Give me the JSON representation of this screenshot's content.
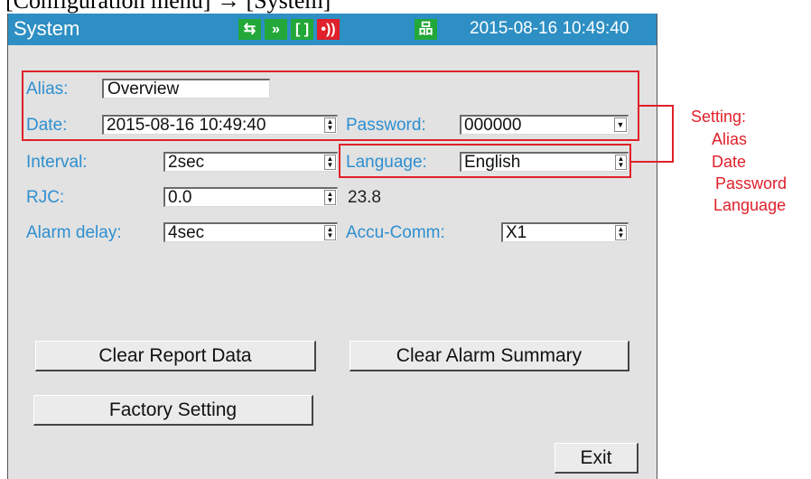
{
  "caption": "[Configuration menu] → [System]",
  "titlebar": {
    "title": "System",
    "datetime": "2015-08-16 10:49:40",
    "icons": [
      "usb-icon",
      "forward-arrows-icon",
      "bracket-icon",
      "signal-icon",
      "network-icon"
    ]
  },
  "form": {
    "alias": {
      "label": "Alias:",
      "value": "Overview"
    },
    "date": {
      "label": "Date:",
      "value": "2015-08-16 10:49:40"
    },
    "password": {
      "label": "Password:",
      "value": "000000"
    },
    "interval": {
      "label": "Interval:",
      "value": "2sec"
    },
    "language": {
      "label": "Language:",
      "value": "English"
    },
    "rjc": {
      "label": "RJC:",
      "value": "0.0",
      "reading": "23.8"
    },
    "alarm_delay": {
      "label": "Alarm delay:",
      "value": "4sec"
    },
    "accu_comm": {
      "label": "Accu-Comm:",
      "value": "X1"
    }
  },
  "buttons": {
    "clear_report": "Clear Report Data",
    "clear_alarm": "Clear Alarm Summary",
    "factory": "Factory Setting",
    "exit": "Exit"
  },
  "annotation": {
    "heading": "Setting:",
    "items": [
      "Alias",
      "Date",
      "Password",
      "Language"
    ]
  },
  "colors": {
    "titlebar": "#2d8fc3",
    "label": "#2e8fd0",
    "highlight": "#e0202a",
    "status_green": "#22a838"
  }
}
